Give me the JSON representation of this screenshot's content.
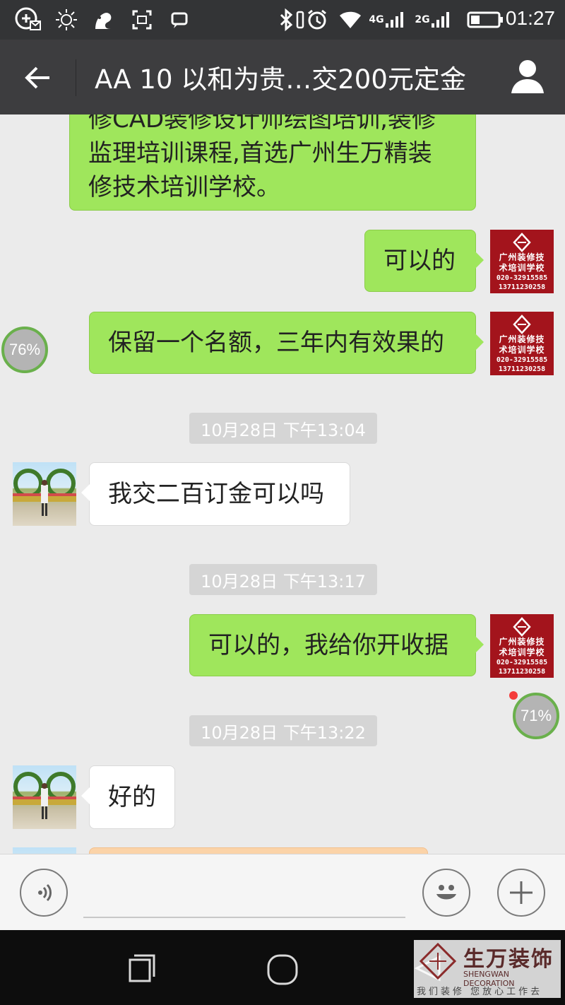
{
  "status_bar": {
    "time": "01:27",
    "network_1": "4G",
    "network_2": "2G",
    "icons": [
      "add-message-icon",
      "brightness-icon",
      "squirrel-app-icon",
      "screenshot-icon",
      "chat-icon",
      "bluetooth-icon",
      "vibrate-icon",
      "alarm-icon",
      "wifi-icon",
      "signal-icon",
      "battery-icon"
    ]
  },
  "header": {
    "title": "AA  10  以和为贵…交200元定金",
    "back_icon": "back-arrow-icon",
    "profile_icon": "person-icon"
  },
  "messages": [
    {
      "side": "right",
      "lines": [
        "修CAD装修设计师绘图培训,装修",
        "监理培训课程,首选广州生万精装",
        "修技术培训学校。"
      ]
    },
    {
      "side": "right",
      "text": "可以的"
    },
    {
      "side": "right",
      "text": "保留一个名额，三年内有效果的"
    },
    {
      "timestamp": "10月28日 下午13:04"
    },
    {
      "side": "left",
      "text": "我交二百订金可以吗"
    },
    {
      "timestamp": "10月28日 下午13:17"
    },
    {
      "side": "right",
      "text": "可以的，我给你开收据"
    },
    {
      "timestamp": "10月28日 下午13:22"
    },
    {
      "side": "left",
      "text": "好的"
    }
  ],
  "school_avatar": {
    "line1": "广州装修技",
    "line2": "术培训学校",
    "phone1": "020-32915585",
    "phone2": "13711230258"
  },
  "floating_badges": [
    {
      "label": "76%"
    },
    {
      "label": "71%"
    }
  ],
  "input_bar": {
    "voice_icon": "voice-icon",
    "emoji_icon": "emoji-icon",
    "plus_icon": "plus-icon"
  },
  "nav_bar": {
    "icons": [
      "back-triangle-icon",
      "home-circle-icon",
      "recent-apps-icon"
    ]
  },
  "watermark": {
    "title": "生万装饰",
    "english": "SHENGWAN DECORATION",
    "slogan": "我们装修  您放心工作去"
  },
  "colors": {
    "title_bar": "#3d3d3f",
    "status_bar": "#333436",
    "sent_bubble": "#9fe65c",
    "received_bubble": "#ffffff",
    "chat_background": "#ebebeb",
    "avatar_red": "#a3141c"
  }
}
